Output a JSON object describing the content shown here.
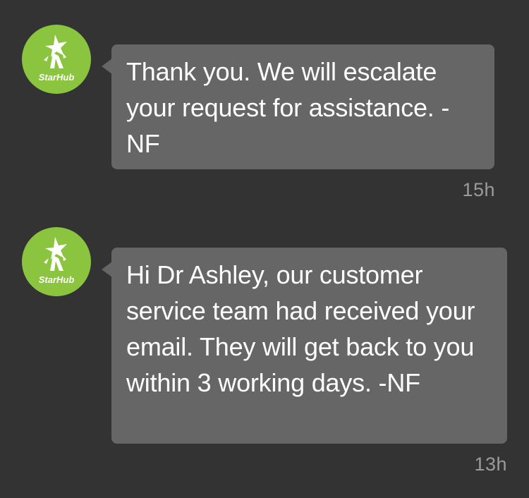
{
  "messages": [
    {
      "sender_logo": "StarHub",
      "text": "Thank you. We will escalate your request for assistance. -NF",
      "time": "15h"
    },
    {
      "sender_logo": "StarHub",
      "text": "Hi Dr Ashley, our customer service team had received your email. They will get back to you within 3 working days. -NF",
      "time": "13h"
    }
  ],
  "colors": {
    "background": "#333333",
    "bubble": "#666666",
    "avatar": "#8bc53f",
    "timestamp": "#9b9b9b"
  },
  "icons": {
    "avatar": "starhub-logo-icon"
  }
}
